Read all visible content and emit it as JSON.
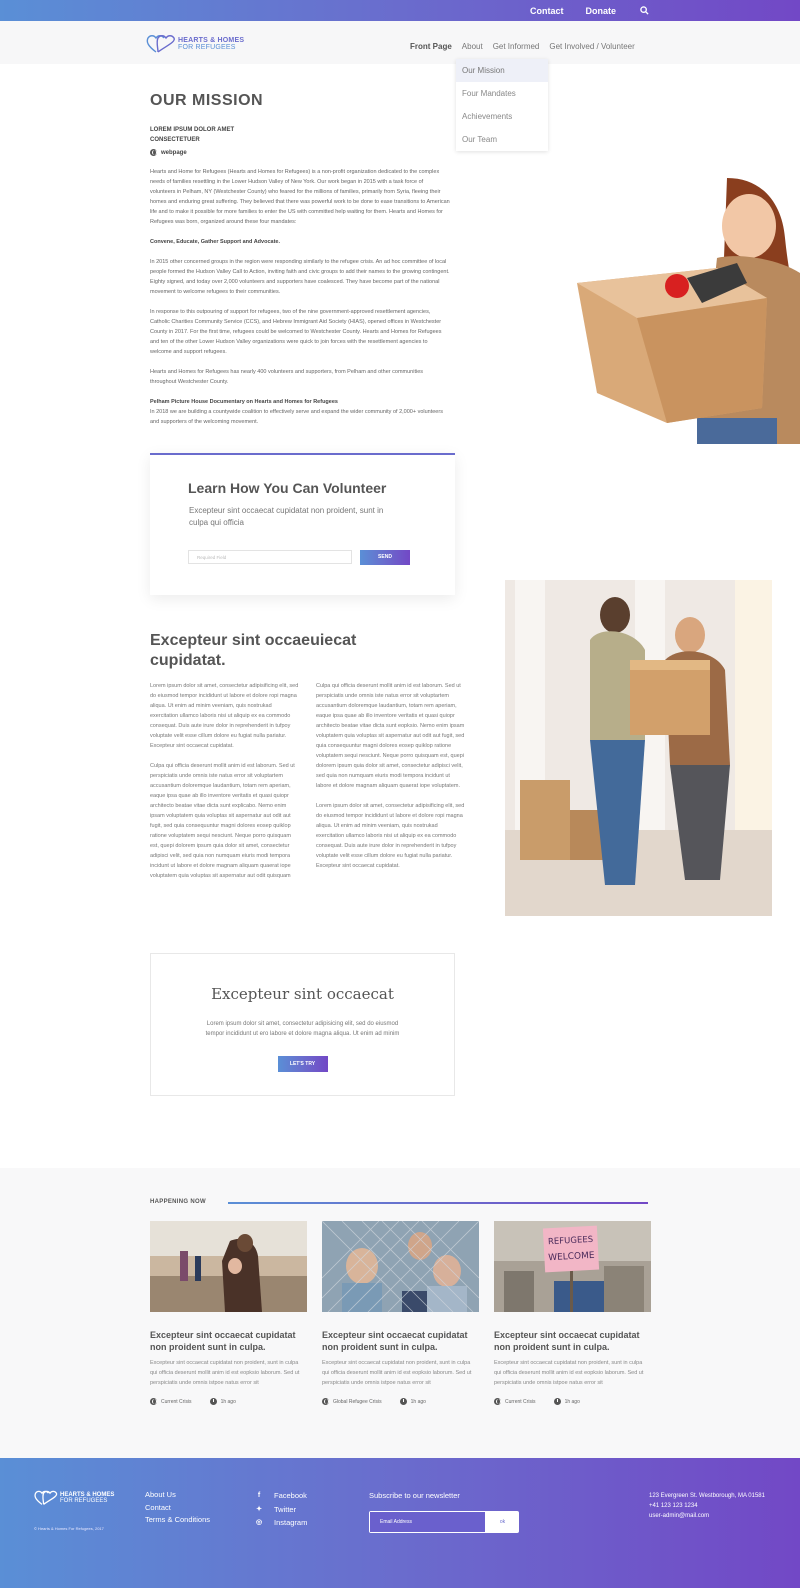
{
  "topbar": {
    "contact": "Contact",
    "donate": "Donate"
  },
  "logo": {
    "line1": "HEARTS & HOMES",
    "line2": "FOR REFUGEES"
  },
  "nav": {
    "front": "Front Page",
    "about": "About",
    "informed": "Get Informed",
    "involved": "Get Involved / Volunteer"
  },
  "dropdown": [
    "Our Mission",
    "Four Mandates",
    "Achievements",
    "Our Team"
  ],
  "mission": {
    "title": "OUR MISSION",
    "subhead": "LOREM IPSUM DOLOR AMET CONSECTETUER",
    "webpage": "webpage",
    "p1": "Hearts and Home for Refugees (Hearts and Homes for Refugees) is a non-profit organization dedicated to the complex needs of families resettling in the Lower Hudson Valley of New York. Our work began in 2015 with a task force of volunteers in Pelham, NY (Westchester County) who feared for the millions of families, primarily from Syria, fleeing their homes and enduring great suffering.  They believed that there was powerful work to be done to ease transitions to American life and to make it possible for more families to enter the US with committed help waiting for them. Hearts and Homes for Refugees was born, organized around these four mandates:",
    "p2": "Convene, Educate, Gather Support and Advocate.",
    "p3": "In 2015 other concerned groups in the region were responding similarly to the refugee crisis. An ad hoc committee of local people formed the Hudson Valley Call to Action, inviting faith and civic groups to add their names to the growing contingent. Eighty signed, and today over 2,000 volunteers and supporters have coalesced. They have become part of the national movement to welcome refugees to their communities.",
    "p4": "In response to this outpouring of support for refugees, two of the nine government-approved resettlement agencies, Catholic Charities Community Service (CCS), and Hebrew Immigrant Aid Society (HIAS), opened offices in Westchester County in 2017.  For the first time, refugees could be welcomed to Westchester County.  Hearts and Homes for Refugees and ten of the other Lower Hudson Valley organizations were quick to join forces with the resettlement agencies to welcome and support refugees.",
    "p5": "Hearts and Homes for Refugees  has nearly 400 volunteers and supporters, from Pelham and other communities throughout Westchester County.",
    "p6_title": "Pelham Picture House Documentary on Hearts and Homes for Refugees",
    "p6": "In 2018 we are building a countywide coalition to effectively serve and expand the wider community of  2,000+ volunteers and supporters of the welcoming movement."
  },
  "volunteer": {
    "title": "Learn How You Can Volunteer",
    "text": "Excepteur sint occaecat cupidatat non proident, sunt in culpa qui officia",
    "placeholder": "Required Field",
    "send": "SEND"
  },
  "excepteur": {
    "title": "Excepteur sint occaeuiecat cupidatat.",
    "c1p1": "Lorem ipsum dolor sit amet, consectetur adipisificing elit, sed do eiusmod tempor incididunt ut labore et dolore ropi magna aliqua. Ut enim ad minim veeniam, quis nostrukad exercitation ullamco laboris nisi ut aliquip ex ea commodo consequat. Duis aute irure dolor in reprehenderit in tufpoy voluptate velit esse cillum dolore eu fugiat nulla pariatur. Excepteur sint occaecat cupidatat.",
    "c1p2": "Culpa qui officia deserunt mollit anim id est laborum. Sed ut perspiciatis unde omnis iste natus error sit voluptartem accusantium doloremque laudantium, totam rem aperiam, eaque ipsa quae ab illo inventore veritatis et quasi quiopr architecto beatae vitae dicta sunt explicabo. Nemo enim ipsam voluptatem quia voluptas sit aspernatur aut odit aut fugit, sed quia consequuntur magni dolores eosep quiklop ratione voluptatem sequi nesciunt. Neque porro quisquam est, quepi dolorem ipsum quia dolor sit amet, consectetur adipisci velit, sed quia non numquam eiuris modi tempora incidunt ut labore et dolore magnam aliquam quaerat iope voluptatem quia voluptas sit aspernatur aut odit quisquam",
    "c2p1": "Culpa qui officia deserunt mollit anim id est laborum. Sed ut perspiciatis unde omnis iste natus error sit voluptartem accusantium doloremque laudantium, totam rem aperiam, eaque ipsa quae ab illo inventore veritatis et quasi quiopr architecto beatae vitae dicta sunt eopksio. Nemo enim ipsam voluptatem quia voluptas sit aspernatur aut odit aut fugit, sed quia consequuntur magni dolores eosep quiklop ratione voluptatem sequi nesciunt. Neque porro quisquam est, quepi dolorem ipsum quia dolor sit amet, consectetur adipisci velit, sed quia non numquam eiuris modi tempora incidunt ut labore et dolore magnam aliquam quaerat iope voluptatem.",
    "c2p2": "Lorem ipsum dolor sit amet, consectetur adipisificing elit, sed do eiusmod tempor incididunt ut labore et dolore ropi magna aliqua. Ut enim ad minim veeniam, quis nostrukad exercitation ullamco laboris nisi ut aliquip ex ea commodo consequat. Duis aute irure dolor in reprehenderit in tufpoy voluptate velit esse cillum dolore eu fugiat nulla pariatur. Excepteur sint occaecat cupidatat."
  },
  "try": {
    "title": "Excepteur sint occaecat",
    "text": "Lorem ipsum dolor sit amet, consectetur adipisicing elit, sed do eiusmod tempor incididunt ut ero labore et dolore magna aliqua. Ut enim ad minim",
    "button": "LET'S TRY"
  },
  "happening": {
    "title": "HAPPENING NOW",
    "cards": [
      {
        "title": "Excepteur sint occaecat cupidatat non proident sunt in culpa.",
        "text": "Excepteur sint occaecat cupidatat non proident, sunt in culpa qui officia deserunt mollit anim id est eopksio laborum. Sed ut perspiciatis unde omnis istpoe natus error sit",
        "tag": "Current Crisis",
        "time": "1h ago"
      },
      {
        "title": "Excepteur sint occaecat cupidatat non proident sunt in culpa.",
        "text": "Excepteur sint occaecat cupidatat non proident, sunt in culpa qui officia deserunt mollit anim id est eopksio laborum. Sed ut perspiciatis unde omnis istpoe natus error sit",
        "tag": "Global Refugee Crisis",
        "time": "1h ago"
      },
      {
        "title": "Excepteur sint occaecat cupidatat non proident sunt in culpa.",
        "text": "Excepteur sint occaecat cupidatat non proident, sunt in culpa qui officia deserunt mollit anim id est eopksio laborum. Sed ut perspiciatis unde omnis istpoe natus error sit",
        "tag": "Current Crisis",
        "time": "1h ago"
      }
    ],
    "sign_line1": "REFUGEES",
    "sign_line2": "WELCOME"
  },
  "footer": {
    "copyright": "© Hearts & Homes For Refugees, 2017",
    "links": [
      "About Us",
      "Contact",
      "Terms & Conditions"
    ],
    "social": [
      "Facebook",
      "Twitter",
      "Instagram"
    ],
    "newsletter": "Subscribe to our newsletter",
    "email_placeholder": "Email Address",
    "ok": "ok",
    "address": "123 Evergreen St. Westborough, MA 01581",
    "phone": "+41 123 123 1234",
    "email": "user-admin@mail.com"
  },
  "colors": {
    "gradient_start": "#5a8fd6",
    "gradient_end": "#7248c6"
  }
}
